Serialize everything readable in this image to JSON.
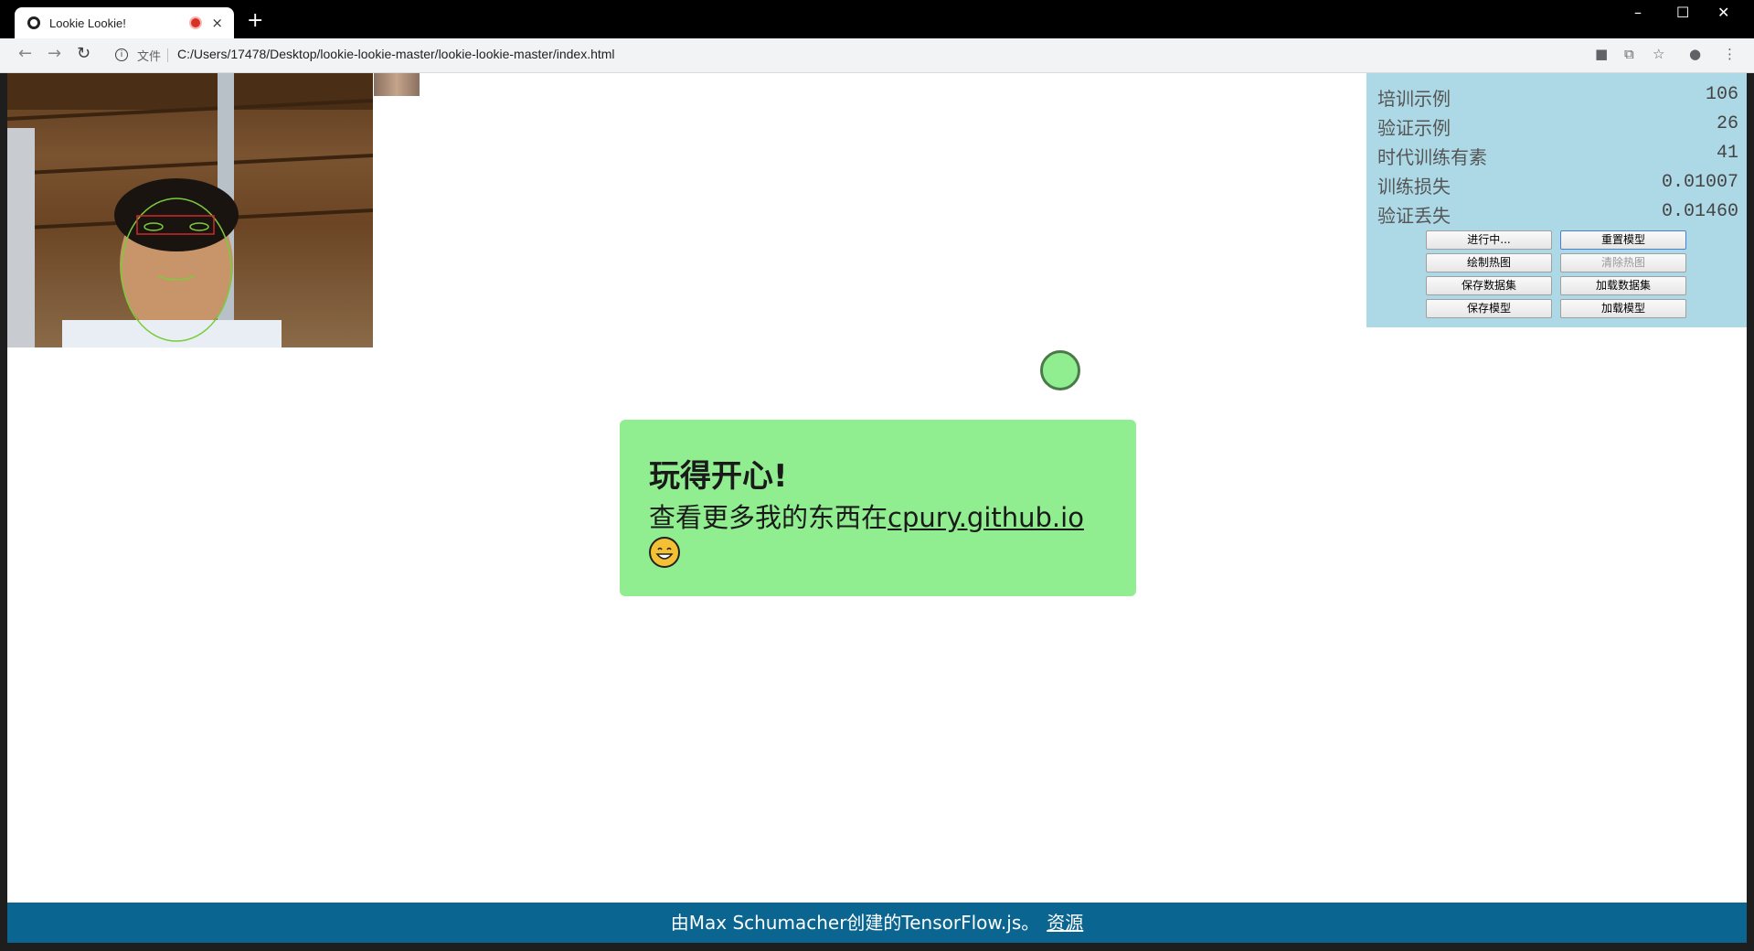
{
  "browser": {
    "tab_title": "Lookie Lookie!",
    "tab_close": "×",
    "new_tab": "+",
    "file_label": "文件",
    "url": "C:/Users/17478/Desktop/lookie-lookie-master/lookie-lookie-master/index.html",
    "window_controls": [
      "–",
      "☐",
      "✕"
    ]
  },
  "stats": [
    {
      "label": "培训示例",
      "value": "106"
    },
    {
      "label": "验证示例",
      "value": "26"
    },
    {
      "label": "时代训练有素",
      "value": "41"
    },
    {
      "label": "训练损失",
      "value": "0.01007"
    },
    {
      "label": "验证丢失",
      "value": "0.01460"
    }
  ],
  "buttons": {
    "in_progress": "进行中...",
    "reset_model": "重置模型",
    "draw_heatmap": "绘制热图",
    "clear_heatmap": "清除热图",
    "save_dataset": "保存数据集",
    "load_dataset": "加载数据集",
    "save_model": "保存模型",
    "load_model": "加载模型"
  },
  "card": {
    "title": "玩得开心!",
    "text": "查看更多我的东西在",
    "link": "cpury.github.io"
  },
  "footer": {
    "text": "由Max Schumacher创建的TensorFlow.js。",
    "link": "资源"
  },
  "colors": {
    "panel_bg": "#add8e6",
    "card_bg": "#90ee90",
    "footer_bg": "#0a6591"
  }
}
